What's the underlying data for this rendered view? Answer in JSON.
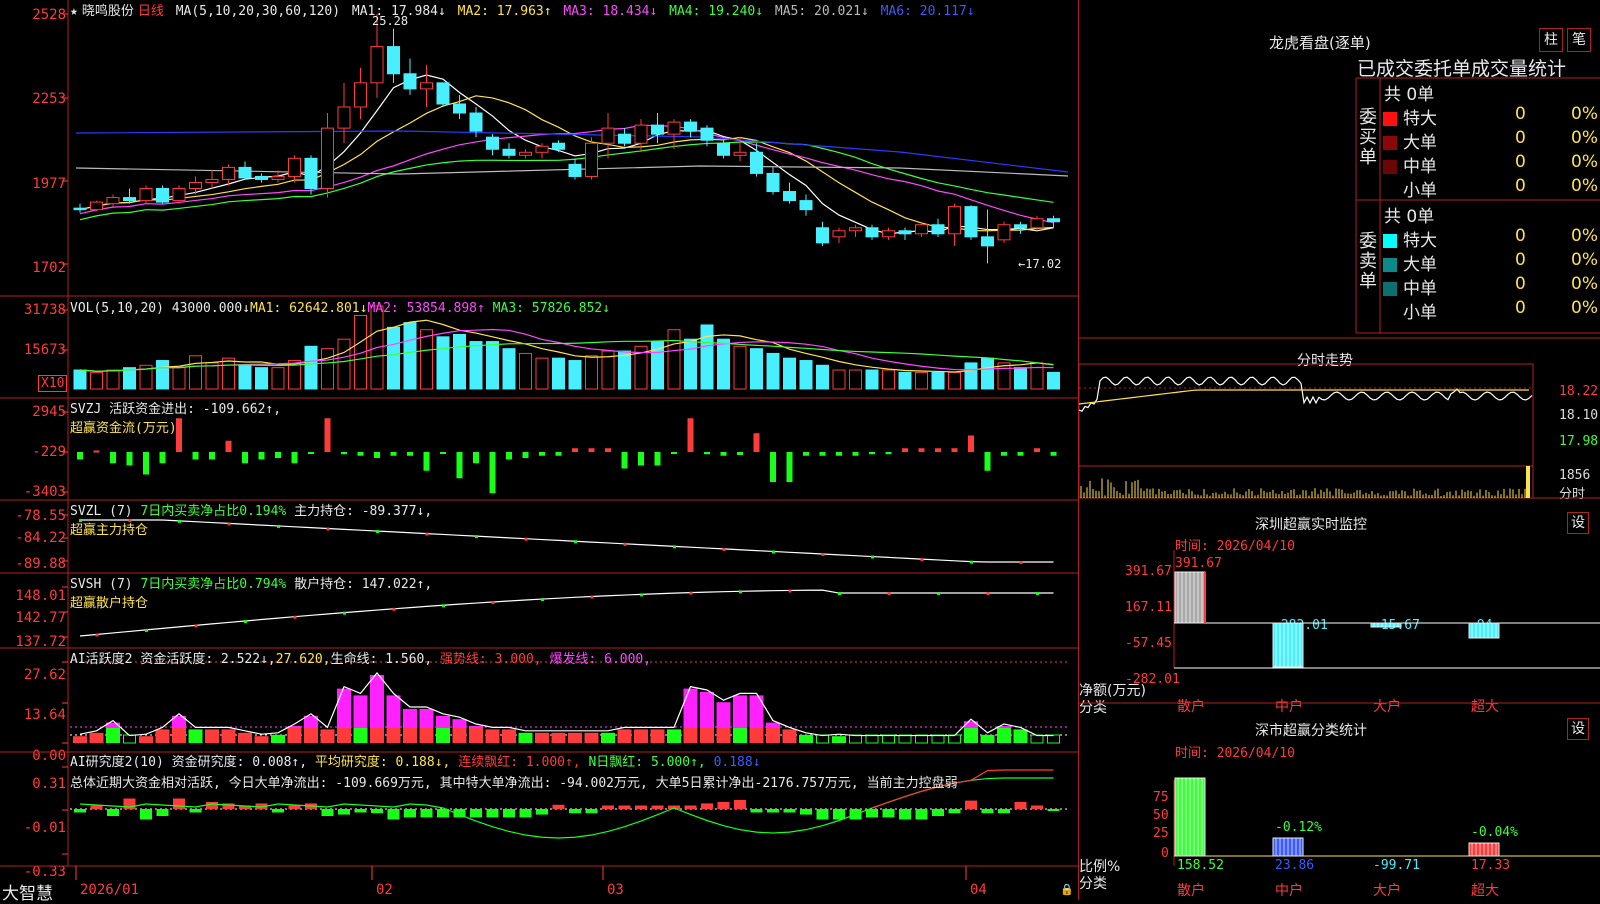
{
  "stock": {
    "star": "★",
    "name": "晓鸣股份",
    "period": "日线"
  },
  "kline_header": {
    "ma_label": "MA(5,10,20,30,60,120)",
    "ma1": "MA1: 17.984↓",
    "ma2": "MA2: 17.963↑",
    "ma3": "MA3: 18.434↓",
    "ma4": "MA4: 19.240↓",
    "ma5": "MA5: 20.021↓",
    "ma6": "MA6: 20.117↓"
  },
  "kline_axis": [
    "2528",
    "2253",
    "1977",
    "1702"
  ],
  "kline_marks": {
    "high": "25.28",
    "low": "←17.02"
  },
  "vol_header": {
    "label": "VOL(5,10,20)",
    "vol": "43000.000↓",
    "ma1": "MA1: 62642.801↓",
    "ma2": "MA2: 53854.898↑",
    "ma3": "MA3: 57826.852↓"
  },
  "vol_axis": [
    "31738",
    "15673"
  ],
  "vol_unit": "X10",
  "svzj": {
    "label": "SVZJ",
    "text": "活跃资金进出: -109.662↑,",
    "sub": "超赢资金流(万元)",
    "axis": [
      "2945",
      "-229",
      "-3403"
    ]
  },
  "svzl": {
    "label": "SVZL (7)",
    "pct": "7日内买卖净占比0.194%",
    "hold": "主力持仓: -89.377↓,",
    "sub": "超赢主力持仓",
    "axis": [
      "-78.55",
      "-84.22",
      "-89.88"
    ]
  },
  "svsh": {
    "label": "SVSH (7)",
    "pct": "7日内买卖净占比0.794%",
    "hold": "散户持仓: 147.022↑,",
    "sub": "超赢散户持仓",
    "axis": [
      "148.01",
      "142.77",
      "137.72"
    ]
  },
  "ai_active": {
    "label": "AI活跃度2",
    "text1": "资金活跃度: 2.522↓,",
    "v2": "27.620,",
    "text3": "生命线: 1.560,",
    "text4": "强势线: 3.000,",
    "text5": "爆发线: 6.000,",
    "axis": [
      "27.62",
      "13.64",
      "0.00"
    ]
  },
  "ai_research": {
    "label": "AI研究度2(10)",
    "t1": "资金研究度: 0.008↑,",
    "t2": "平均研究度: 0.188↓,",
    "t3": "连续飘红: 1.000↑,",
    "t4": "N日飘红: 5.000↑,",
    "t5": "0.188↓",
    "summary": "总体近期大资金相对活跃, 今日大单净流出: -109.669万元, 其中特大单净流出: -94.002万元, 大单5日累计净出-2176.757万元, 当前主力控盘弱",
    "axis": [
      "0.31",
      "-0.01",
      "-0.33"
    ]
  },
  "x_axis": [
    "2026/01",
    "02",
    "03",
    "04"
  ],
  "brand": "大智慧",
  "right": {
    "dragon_title": "龙虎看盘(逐单)",
    "btn_zhu": "柱",
    "btn_bi": "笔",
    "tabs": "已成交委托单成交量统计",
    "buy_label": "委买单",
    "sell_label": "委卖单",
    "buy_total": "共 0单",
    "sell_total": "共 0单",
    "buy_rows": [
      {
        "name": "特大",
        "count": "0",
        "pct": "0%",
        "color": "#ff1010"
      },
      {
        "name": "大单",
        "count": "0",
        "pct": "0%",
        "color": "#8a0808"
      },
      {
        "name": "中单",
        "count": "0",
        "pct": "0%",
        "color": "#6a0606"
      },
      {
        "name": "小单",
        "count": "0",
        "pct": "0%",
        "color": ""
      }
    ],
    "sell_rows": [
      {
        "name": "特大",
        "count": "0",
        "pct": "0%",
        "color": "#00ffff"
      },
      {
        "name": "大单",
        "count": "0",
        "pct": "0%",
        "color": "#0b8a8a"
      },
      {
        "name": "中单",
        "count": "0",
        "pct": "0%",
        "color": "#0b7070"
      },
      {
        "name": "小单",
        "count": "0",
        "pct": "0%",
        "color": ""
      }
    ],
    "intraday_title": "分时走势",
    "intraday_axis": [
      "18.22",
      "18.10",
      "17.98",
      "1856",
      "分时"
    ],
    "monitor": {
      "title": "深圳超赢实时监控",
      "btn": "设",
      "time": "时间: 2026/04/10",
      "axis": [
        "391.67",
        "167.11",
        "-57.45",
        "-282.01"
      ],
      "y_label_1": "净额(万元)",
      "y_label_2": "分类",
      "cats": [
        "散户",
        "中户",
        "大户",
        "超大"
      ],
      "values": [
        "391.67",
        "-282.01",
        "-15.67",
        "-94"
      ]
    },
    "stats": {
      "title": "深市超赢分类统计",
      "btn": "设",
      "time": "时间: 2026/04/10",
      "axis": [
        "75",
        "50",
        "25",
        "0"
      ],
      "y_label_1": "比例%",
      "y_label_2": "分类",
      "cats": [
        "散户",
        "中户",
        "大户",
        "超大"
      ],
      "top_labels": [
        "",
        "-0.12%",
        "",
        "-0.04%"
      ],
      "values": [
        "158.52",
        "23.86",
        "-99.71",
        "17.33"
      ]
    }
  },
  "chart_data": [
    {
      "type": "candlestick",
      "title": "晓鸣股份 日线",
      "ylim": [
        17.02,
        25.28
      ],
      "note": "approximate OHLC read from chart (yuan)",
      "candles": [
        [
          18.85,
          19.0,
          18.7,
          18.8
        ],
        [
          18.8,
          19.1,
          18.75,
          19.05
        ],
        [
          19.0,
          19.3,
          18.9,
          19.2
        ],
        [
          19.2,
          19.5,
          19.0,
          19.1
        ],
        [
          19.1,
          19.6,
          19.0,
          19.5
        ],
        [
          19.5,
          19.6,
          19.0,
          19.05
        ],
        [
          19.1,
          19.6,
          19.0,
          19.5
        ],
        [
          19.5,
          19.9,
          19.3,
          19.7
        ],
        [
          19.7,
          20.1,
          19.5,
          19.8
        ],
        [
          19.8,
          20.3,
          19.6,
          20.2
        ],
        [
          20.2,
          20.4,
          19.8,
          19.85
        ],
        [
          19.9,
          20.0,
          19.7,
          19.8
        ],
        [
          19.8,
          20.1,
          19.7,
          19.9
        ],
        [
          19.9,
          20.6,
          19.7,
          20.5
        ],
        [
          20.5,
          20.6,
          19.3,
          19.5
        ],
        [
          19.5,
          22.0,
          19.2,
          21.5
        ],
        [
          21.5,
          23.0,
          21.0,
          22.2
        ],
        [
          22.2,
          23.5,
          21.8,
          23.0
        ],
        [
          23.0,
          25.28,
          22.5,
          24.2
        ],
        [
          24.2,
          24.8,
          23.0,
          23.3
        ],
        [
          23.3,
          23.8,
          22.6,
          22.8
        ],
        [
          22.8,
          23.6,
          22.2,
          23.0
        ],
        [
          23.0,
          23.0,
          22.2,
          22.3
        ],
        [
          22.3,
          22.6,
          21.8,
          22.0
        ],
        [
          22.0,
          22.2,
          21.2,
          21.4
        ],
        [
          21.2,
          21.3,
          20.6,
          20.8
        ],
        [
          20.8,
          21.0,
          20.5,
          20.6
        ],
        [
          20.6,
          20.8,
          20.5,
          20.7
        ],
        [
          20.7,
          21.0,
          20.5,
          20.9
        ],
        [
          21.0,
          21.1,
          20.7,
          20.8
        ],
        [
          20.3,
          20.5,
          19.8,
          19.9
        ],
        [
          19.9,
          21.2,
          19.8,
          21.0
        ],
        [
          21.0,
          22.0,
          20.5,
          21.5
        ],
        [
          21.3,
          21.5,
          20.9,
          21.0
        ],
        [
          21.0,
          21.8,
          20.7,
          21.6
        ],
        [
          21.6,
          22.0,
          21.0,
          21.3
        ],
        [
          21.3,
          21.8,
          20.8,
          21.7
        ],
        [
          21.7,
          21.8,
          21.2,
          21.4
        ],
        [
          21.5,
          21.6,
          20.9,
          21.1
        ],
        [
          21.0,
          21.1,
          20.5,
          20.6
        ],
        [
          20.6,
          21.2,
          20.4,
          20.7
        ],
        [
          20.7,
          21.0,
          19.9,
          20.0
        ],
        [
          20.0,
          20.2,
          19.3,
          19.4
        ],
        [
          19.4,
          19.7,
          19.0,
          19.1
        ],
        [
          19.1,
          19.3,
          18.6,
          18.8
        ],
        [
          18.2,
          18.4,
          17.6,
          17.7
        ],
        [
          17.9,
          18.2,
          17.7,
          18.1
        ],
        [
          18.1,
          18.3,
          17.9,
          18.2
        ],
        [
          18.2,
          18.3,
          17.8,
          17.9
        ],
        [
          17.9,
          18.2,
          17.8,
          18.1
        ],
        [
          18.1,
          18.2,
          17.8,
          18.0
        ],
        [
          18.0,
          18.4,
          17.9,
          18.3
        ],
        [
          18.3,
          18.5,
          17.9,
          18.0
        ],
        [
          18.0,
          19.0,
          17.6,
          18.9
        ],
        [
          18.9,
          18.95,
          17.8,
          17.9
        ],
        [
          17.9,
          18.8,
          17.02,
          17.6
        ],
        [
          17.8,
          18.4,
          17.7,
          18.3
        ],
        [
          18.3,
          18.4,
          18.0,
          18.2
        ],
        [
          18.2,
          18.6,
          18.1,
          18.5
        ],
        [
          18.5,
          18.6,
          18.2,
          18.4
        ]
      ]
    },
    {
      "type": "bar",
      "title": "VOL(5,10,20)",
      "note": "approximate volume (x10 shares)",
      "values": [
        8,
        7,
        8,
        9,
        10,
        12,
        9,
        14,
        11,
        13,
        10,
        9,
        9,
        12,
        18,
        17,
        21,
        31,
        35,
        26,
        28,
        25,
        22,
        23,
        20,
        20,
        17,
        15,
        13,
        13,
        12,
        14,
        16,
        16,
        18,
        20,
        25,
        21,
        27,
        21,
        18,
        17,
        15,
        13,
        12,
        10,
        8,
        8,
        8,
        8,
        7,
        7,
        7,
        7,
        11,
        13,
        11,
        9,
        11,
        7
      ]
    }
  ]
}
